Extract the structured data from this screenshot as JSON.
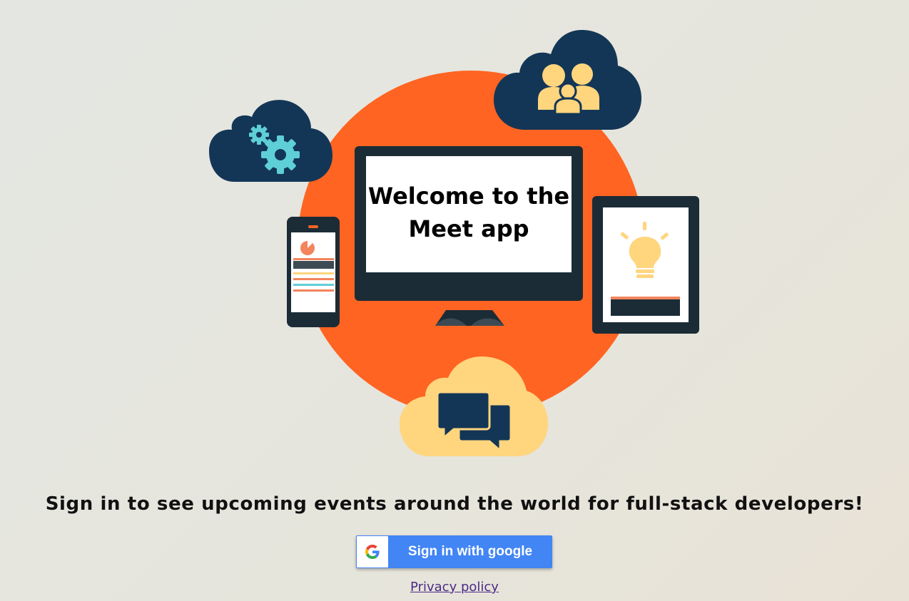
{
  "hero": {
    "title_line1": "Welcome to the",
    "title_line2": "Meet app"
  },
  "tagline": "Sign in to see upcoming events around the world for full-stack developers!",
  "google_button": {
    "label": "Sign in with google",
    "icon": "google-logo-icon"
  },
  "privacy_link": {
    "label": "Privacy policy"
  },
  "colors": {
    "accent_orange": "#ff6422",
    "navy": "#133656",
    "dark_device": "#1b2c37",
    "yellow": "#ffd57e",
    "teal": "#5fcfd7",
    "google_blue": "#4285f4",
    "link": "#4b2a86"
  }
}
